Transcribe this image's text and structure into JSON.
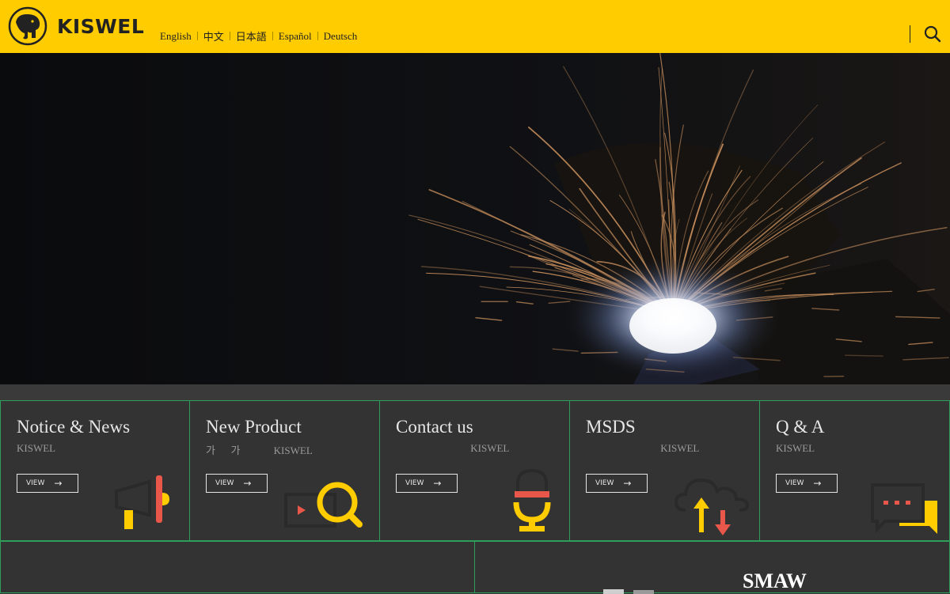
{
  "header": {
    "logo_text": "KISWEL",
    "languages": [
      "English",
      "中文",
      "日本語",
      "Español",
      "Deutsch"
    ]
  },
  "cards": [
    {
      "title": "Notice & News",
      "subtitle": "KISWEL",
      "button": "VIEW",
      "icon": "megaphone-icon"
    },
    {
      "title": "New Product",
      "subtitle": "가      가             KISWEL",
      "button": "VIEW",
      "icon": "product-search-icon"
    },
    {
      "title": "Contact us",
      "subtitle": "                             KISWEL",
      "button": "VIEW",
      "icon": "microphone-icon"
    },
    {
      "title": "MSDS",
      "subtitle": "                             KISWEL",
      "button": "VIEW",
      "icon": "cloud-transfer-icon"
    },
    {
      "title": "Q & A",
      "subtitle": "KISWEL",
      "button": "VIEW",
      "icon": "chat-bubbles-icon"
    }
  ],
  "bottom": {
    "right_title": "SMAW"
  },
  "colors": {
    "brand_yellow": "#ffcc00",
    "panel": "#333333",
    "border_green": "#2e9e5a",
    "accent_red": "#e8574a"
  }
}
